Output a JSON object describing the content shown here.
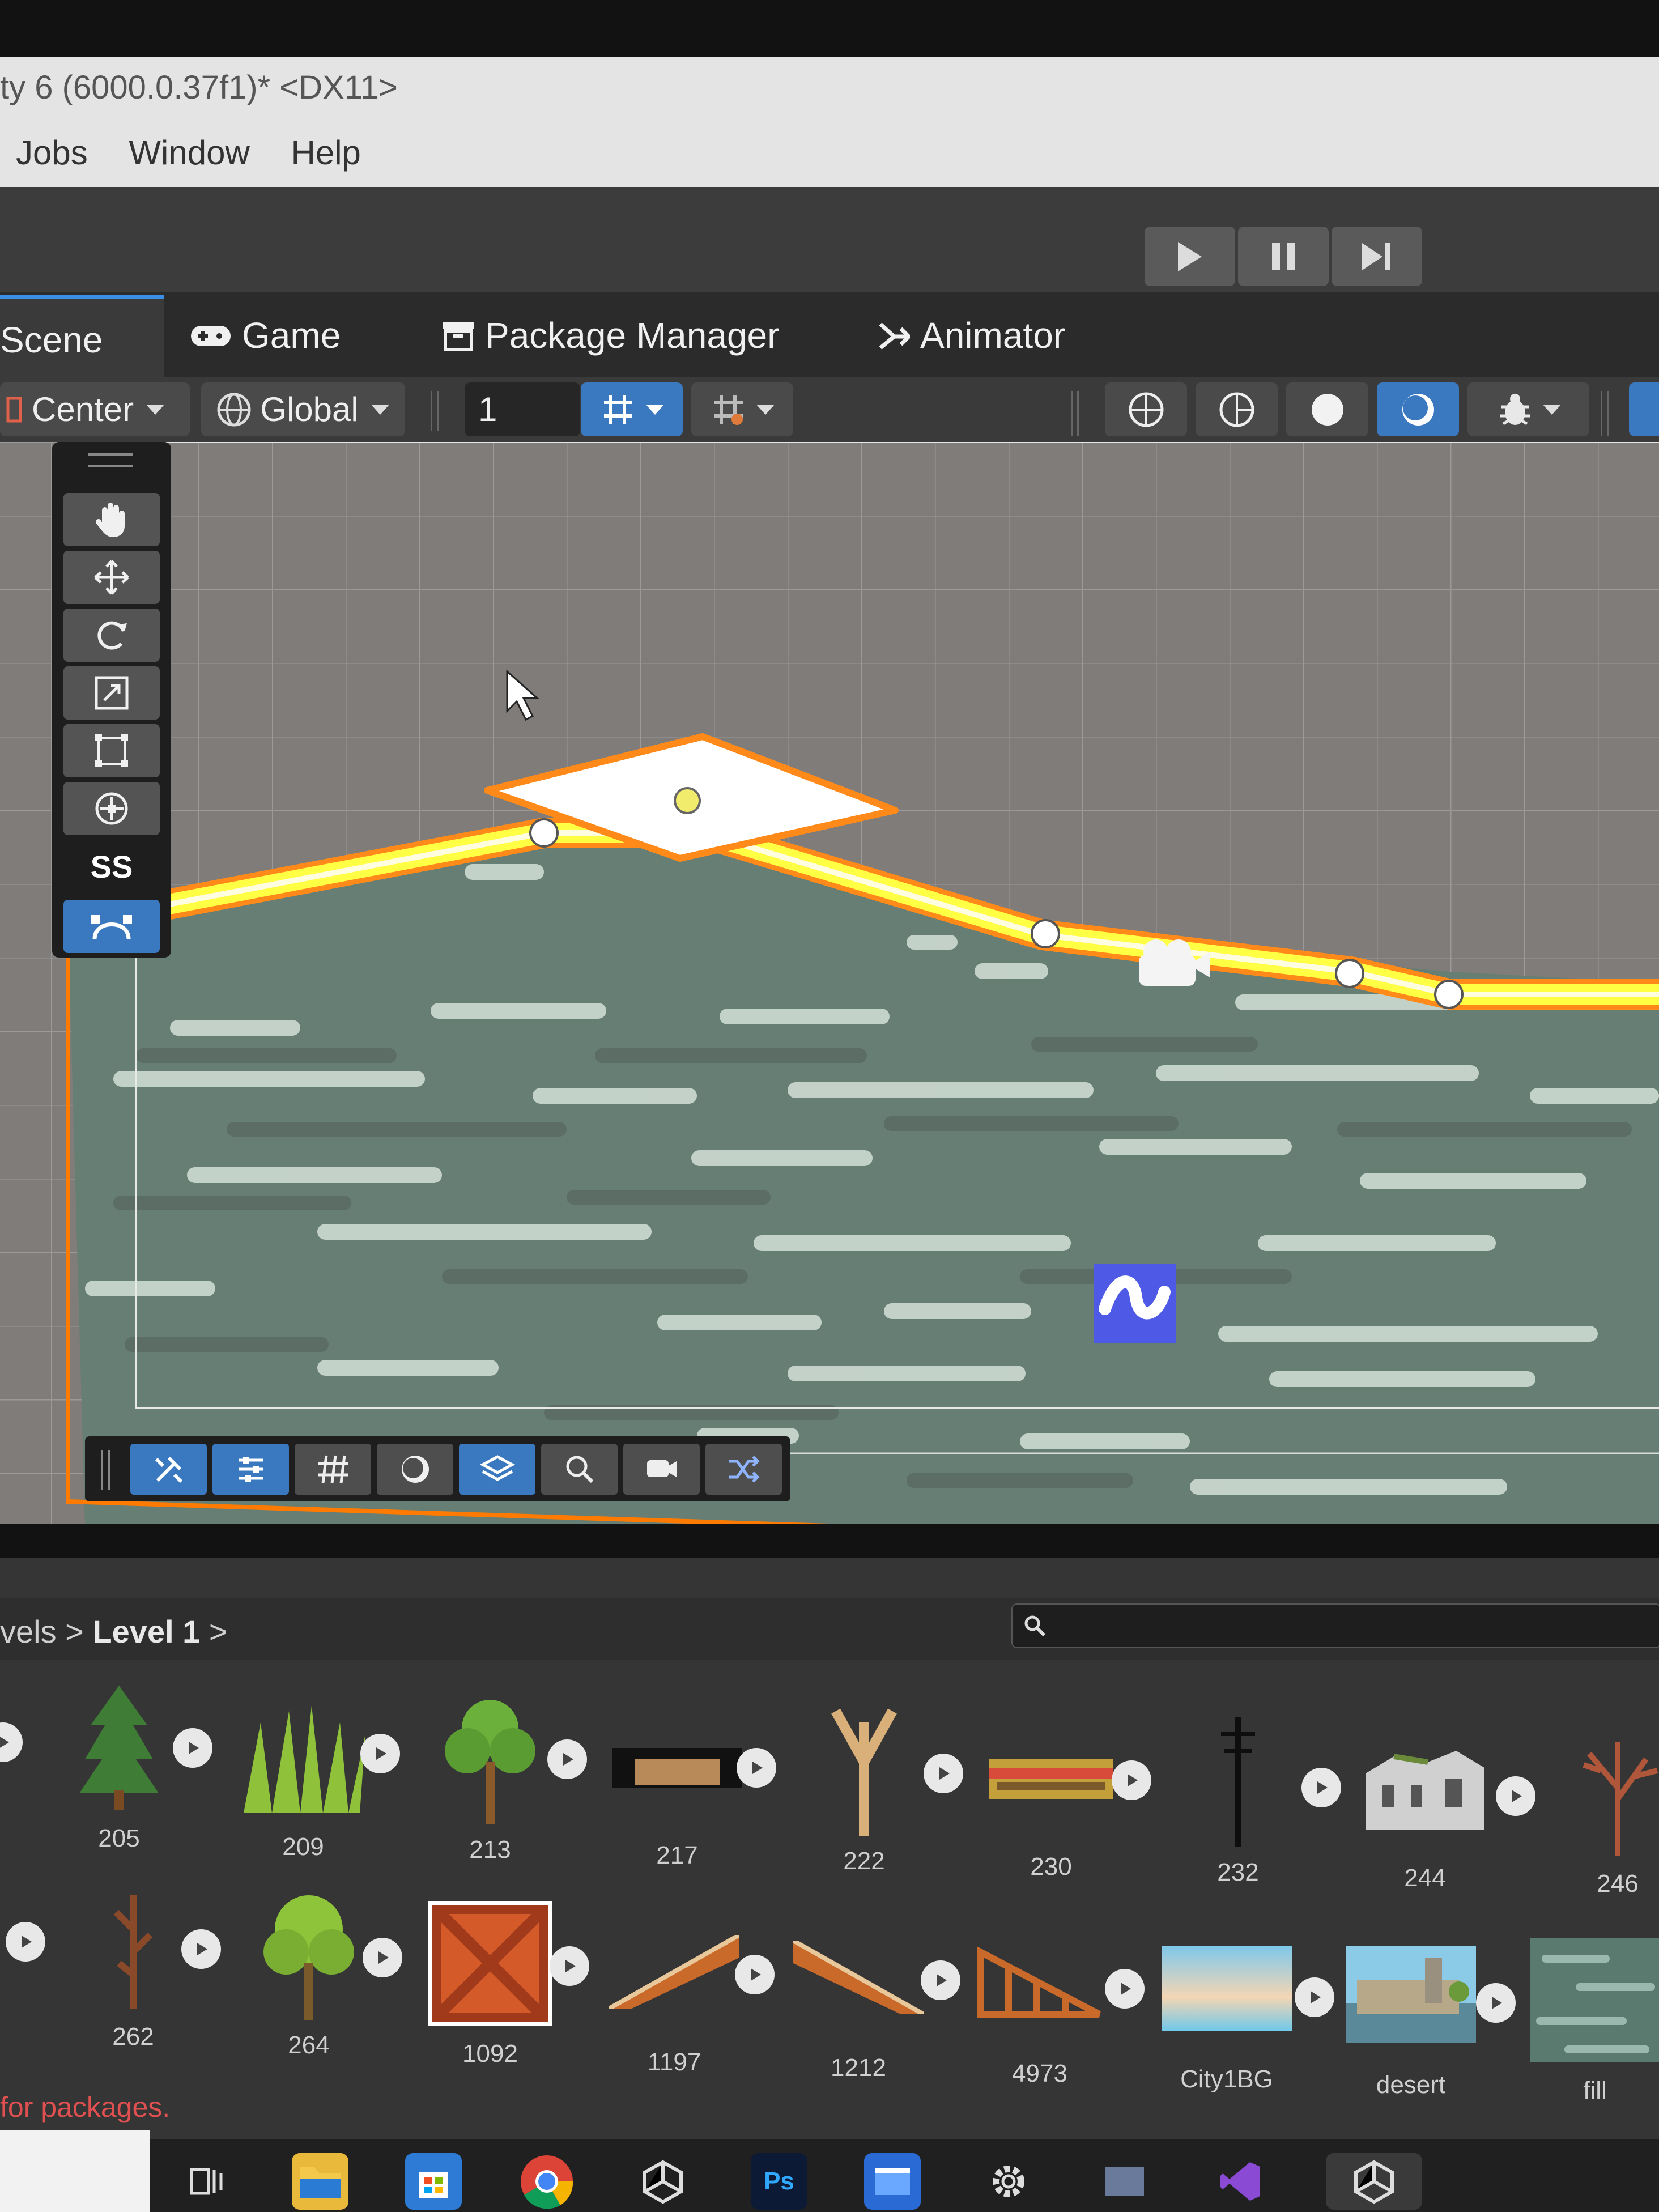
{
  "window": {
    "title": "ty 6 (6000.0.37f1)* <DX11>"
  },
  "menu": [
    "Jobs",
    "Window",
    "Help"
  ],
  "tabs": {
    "scene": "Scene",
    "game": "Game",
    "package_manager": "Package Manager",
    "animator": "Animator"
  },
  "scene_toolbar": {
    "pivot": "Center",
    "space": "Global",
    "grid_value": "1"
  },
  "tools": {
    "ss_label": "SS"
  },
  "project": {
    "breadcrumb_prefix": "vels",
    "breadcrumb_current": "Level 1",
    "assets_row1": [
      "205",
      "209",
      "213",
      "217",
      "222",
      "230",
      "232",
      "244",
      "246"
    ],
    "assets_row2": [
      "262",
      "264",
      "1092",
      "1197",
      "1212",
      "4973",
      "City1BG",
      "desert",
      "fill"
    ]
  },
  "status": "for packages.",
  "taskbar": {
    "ps_label": "Ps"
  },
  "colors": {
    "accent": "#3a79bf",
    "selection": "#ff7a00",
    "spline": "#ffff44",
    "ground": "#667e74"
  }
}
